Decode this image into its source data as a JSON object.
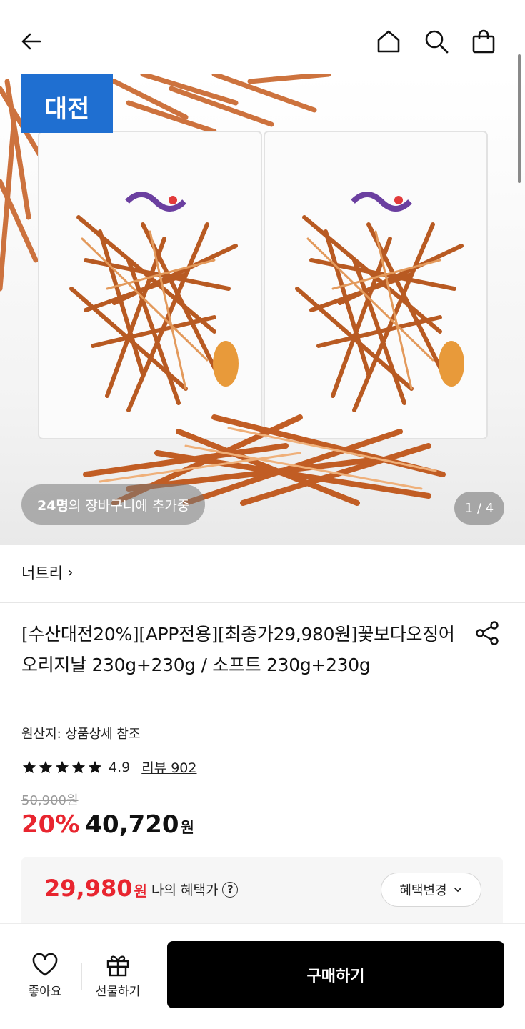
{
  "header": {
    "back_icon": "arrow-left-icon",
    "home_icon": "home-icon",
    "search_icon": "search-icon",
    "cart_icon": "shopping-bag-icon"
  },
  "hero": {
    "event_badge": "대전",
    "cart_count": "24명",
    "cart_text": "의 장바구니에 추가중",
    "pager": "1 / 4"
  },
  "seller": {
    "name": "너트리",
    "chevron": "›"
  },
  "product": {
    "title": "[수산대전20%][APP전용][최종가29,980원]꽃보다오징어 오리지날 230g+230g / 소프트 230g+230g",
    "origin": "원산지: 상품상세 참조",
    "rating": "4.9",
    "review_label": "리뷰 902",
    "original_price": "50,900원",
    "discount": "20%",
    "price": "40,720",
    "price_unit": "원"
  },
  "benefit": {
    "price": "29,980",
    "unit": "원",
    "label": "나의 혜택가",
    "help": "?",
    "change_button": "혜택변경"
  },
  "bottom_bar": {
    "like_label": "좋아요",
    "gift_label": "선물하기",
    "buy_label": "구매하기"
  },
  "colors": {
    "accent_red": "#e8252f",
    "badge_blue": "#1f6fd1",
    "buy_button": "#000000"
  }
}
